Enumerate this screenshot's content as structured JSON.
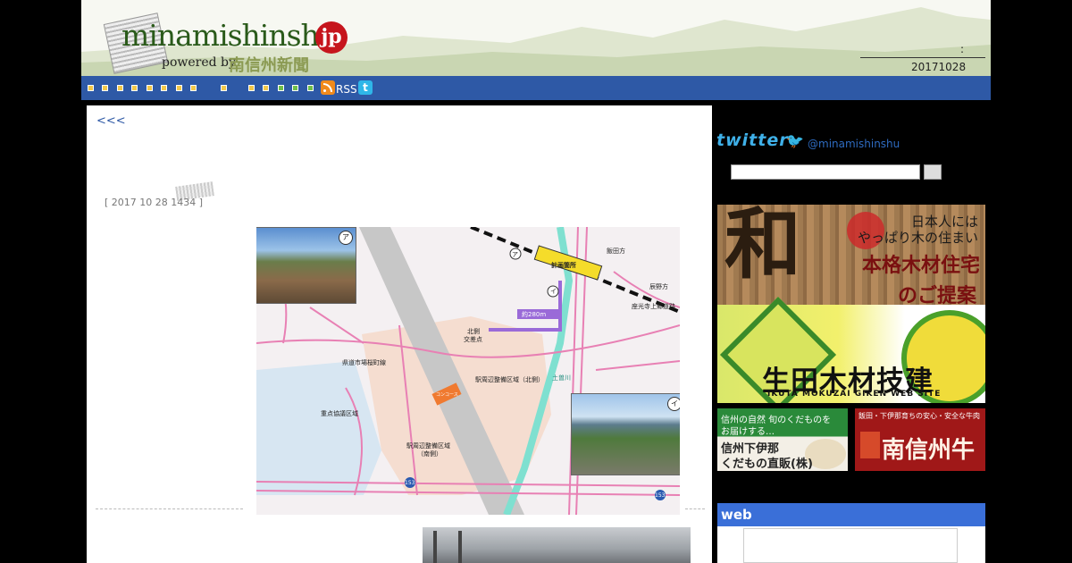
{
  "header": {
    "logo_text": "minamishinshu",
    "logo_suffix": "jp",
    "powered_by": "powered by",
    "newspaper_name": "南信州新聞",
    "colon": ":",
    "date": "20171028"
  },
  "nav": {
    "rss_label": "RSS",
    "twitter_icon_letter": "t"
  },
  "article": {
    "back_link": "<<<",
    "meta": "[ 2017 10 28  1434 ]",
    "map_labels": {
      "plan_area": "計画箇所",
      "distance": "約280m",
      "north_intersection_1": "北側",
      "north_intersection_2": "交差点",
      "north_district_1": "駅周辺整備区域（北側）",
      "south_district_1": "駅周辺整備区域",
      "south_district_2": "（南側）",
      "priority_area": "重点協議区域",
      "concourse": "コンコース",
      "road_prefectural": "県道市場桜町線",
      "river": "土曽川",
      "to_iida": "飯田方",
      "to_tatsuno": "辰野方",
      "shinden": "座光寺上郷道路",
      "route_153_a": "153",
      "route_153_b": "153",
      "photo_label_a": "ア",
      "photo_label_b": "イ",
      "marker_a": "ア",
      "marker_b": "イ"
    }
  },
  "sidebar": {
    "twitter_logo": "twitter",
    "twitter_handle": "@minamishinshu",
    "search_placeholder": "",
    "ad_main": {
      "line1": "日本人には",
      "line2": "やっぱり木の住まい",
      "line3": "本格木材住宅",
      "line4": "のご提案",
      "company": "生田木材技建",
      "company_en": "IKUTA MOKUZAI GIKEN WEB SITE"
    },
    "ad_fruit": {
      "line1": "信州の自然  旬のくだものを",
      "line2": "お届けする…",
      "line3": "信州下伊那",
      "line4": "くだもの直販(株)"
    },
    "ad_beef": {
      "line1": "飯田・下伊那育ちの安心・安全な牛肉",
      "line2": "南信州牛"
    },
    "web_heading": "web"
  },
  "colors": {
    "nav_blue": "#2e59a6",
    "web_blue": "#3a6fd8",
    "logo_red": "#c6151d"
  }
}
